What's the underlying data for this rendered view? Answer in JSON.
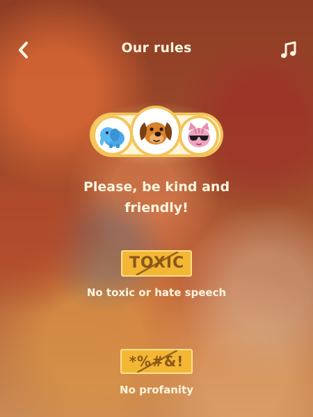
{
  "header": {
    "title": "Our rules",
    "back_icon": "chevron-left-icon",
    "music_icon": "music-note-icon"
  },
  "avatars": [
    {
      "name": "elephant",
      "icon": "elephant-avatar-icon"
    },
    {
      "name": "dog",
      "icon": "dog-avatar-icon"
    },
    {
      "name": "cat",
      "icon": "cat-sunglasses-avatar-icon"
    }
  ],
  "headline": "Please, be kind and\nfriendly!",
  "rules": [
    {
      "badge": "TOXIC",
      "label": "No toxic or hate speech"
    },
    {
      "badge": "*%#&!",
      "label": "No profanity"
    }
  ],
  "colors": {
    "text": "#fff6e0",
    "badge_fill": "#f4b735",
    "badge_text": "#8a5617",
    "avatar_ring": "#f3c45a"
  }
}
